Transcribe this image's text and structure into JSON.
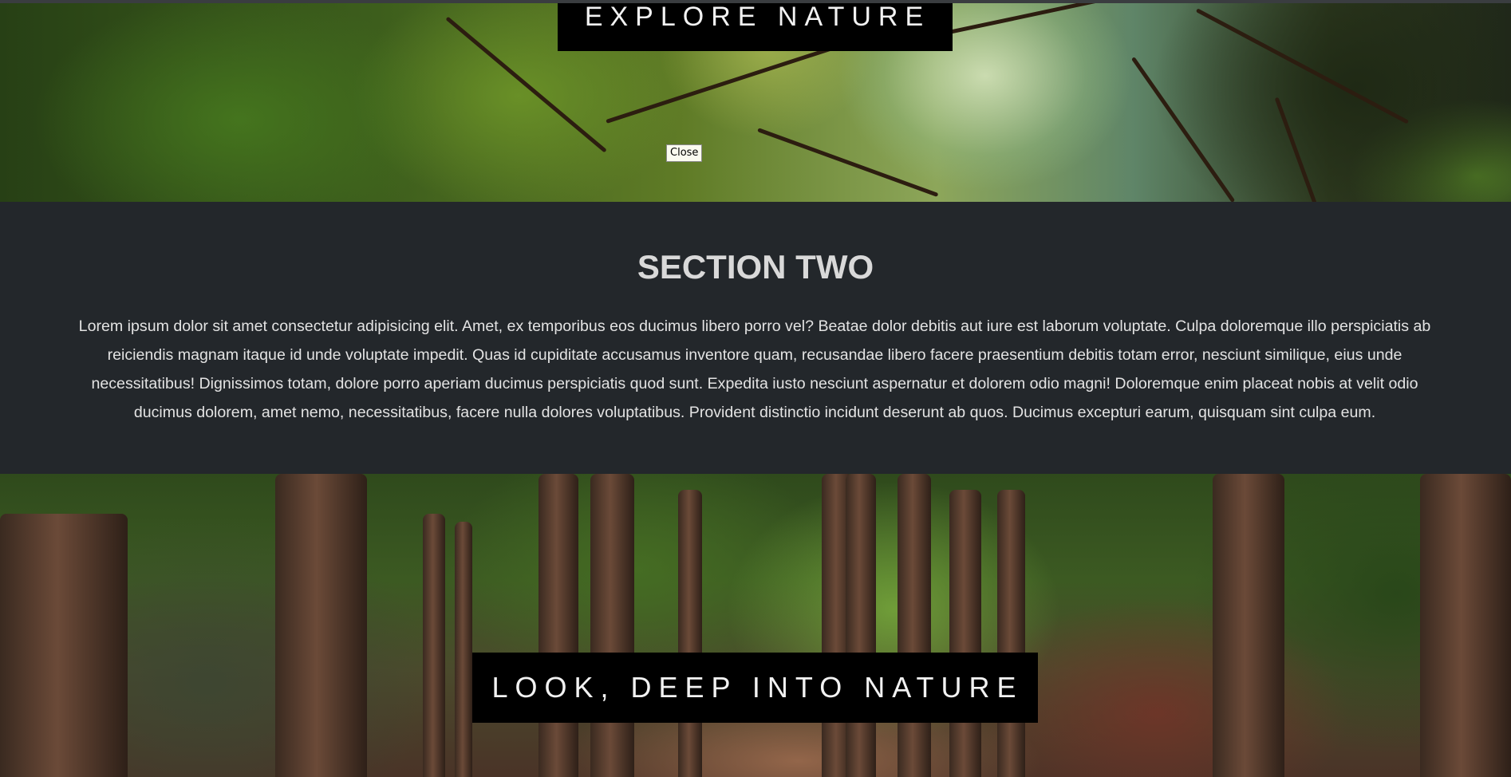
{
  "hero_one": {
    "title": "EXPLORE NATURE",
    "tooltip": "Close"
  },
  "section_two": {
    "heading": "SECTION TWO",
    "body": "Lorem ipsum dolor sit amet consectetur adipisicing elit. Amet, ex temporibus eos ducimus libero porro vel? Beatae dolor debitis aut iure est laborum voluptate. Culpa doloremque illo perspiciatis ab reiciendis magnam itaque id unde voluptate impedit. Quas id cupiditate accusamus inventore quam, recusandae libero facere praesentium debitis totam error, nesciunt similique, eius unde necessitatibus! Dignissimos totam, dolore porro aperiam ducimus perspiciatis quod sunt. Expedita iusto nesciunt aspernatur et dolorem odio magni! Doloremque enim placeat nobis at velit odio ducimus dolorem, amet nemo, necessitatibus, facere nulla dolores voluptatibus. Provident distinctio incidunt deserunt ab quos. Ducimus excepturi earum, quisquam sint culpa eum."
  },
  "hero_two": {
    "title": "LOOK, DEEP INTO NATURE"
  },
  "colors": {
    "section_bg": "#23272b",
    "title_box_bg": "#000000",
    "text_light": "#e3e3e3"
  }
}
